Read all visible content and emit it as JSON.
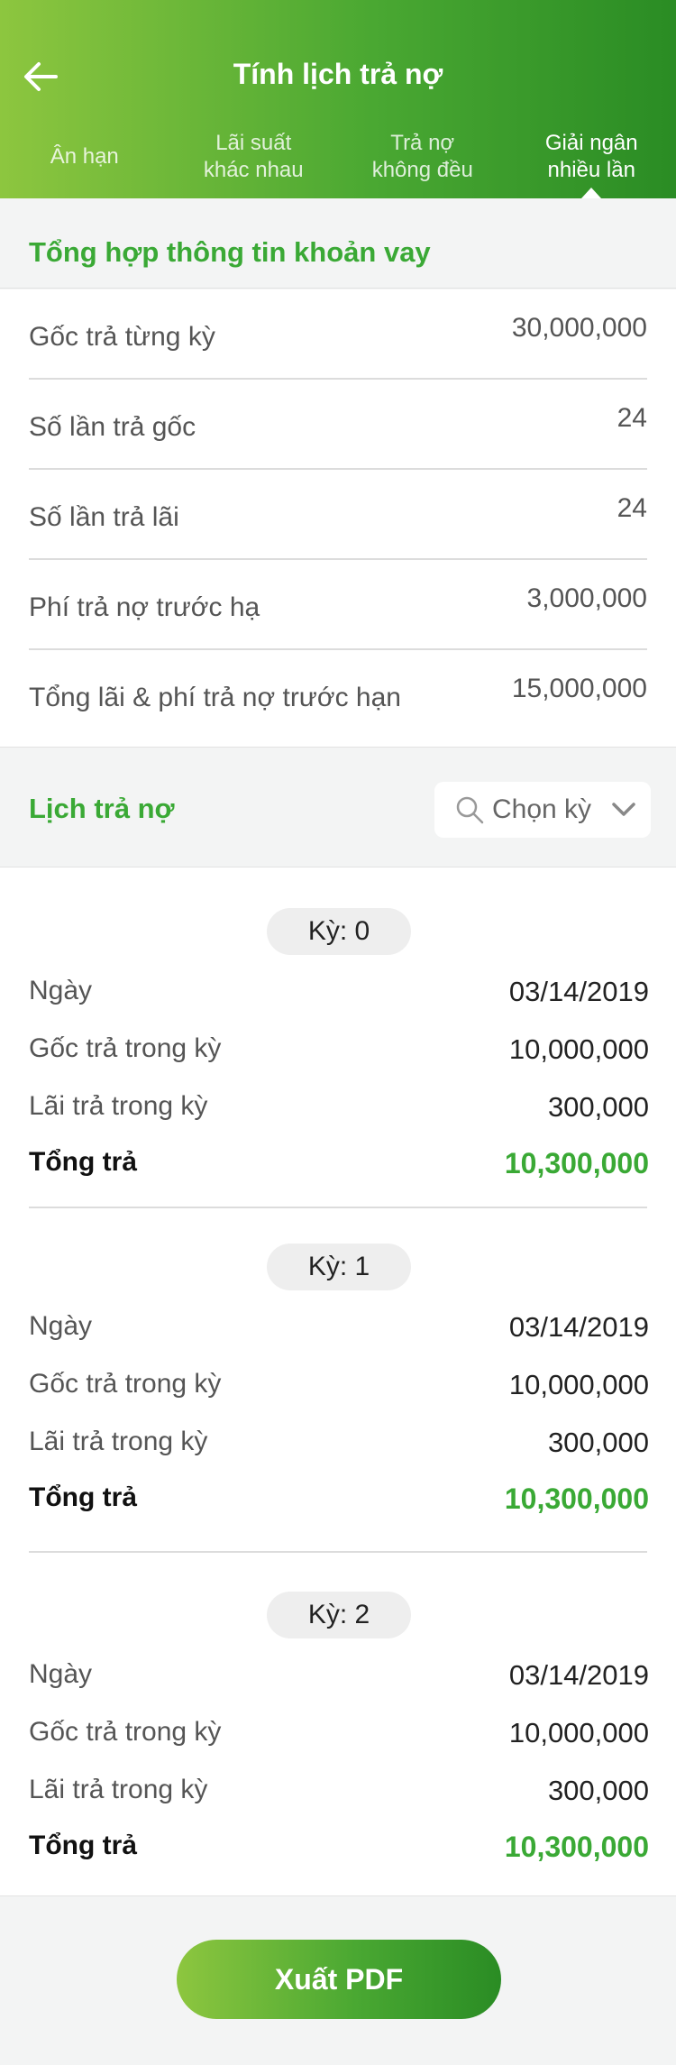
{
  "header": {
    "title": "Tính lịch trả nợ",
    "back_icon": "arrow-left-icon",
    "tabs": [
      {
        "label": "Ân hạn",
        "active": false
      },
      {
        "label": "Lãi suất\nkhác nhau",
        "active": false
      },
      {
        "label": "Trả nợ\nkhông đều",
        "active": false
      },
      {
        "label": "Giải ngân\nnhiều lần",
        "active": true
      }
    ]
  },
  "summary": {
    "title": "Tổng hợp thông tin khoản vay",
    "rows": [
      {
        "label": "Gốc trả từng kỳ",
        "value": "30,000,000"
      },
      {
        "label": "Số lần trả gốc",
        "value": "24"
      },
      {
        "label": "Số lần trả lãi",
        "value": "24"
      },
      {
        "label": "Phí trả nợ trước hạ",
        "value": "3,000,000"
      },
      {
        "label": "Tổng lãi & phí trả nợ trước hạn",
        "value": "15,000,000"
      }
    ]
  },
  "schedule": {
    "title": "Lịch trả nợ",
    "select_placeholder": "Chọn kỳ",
    "periods": [
      {
        "badge": "Kỳ: 0",
        "date_label": "Ngày",
        "date": "03/14/2019",
        "principal_label": "Gốc trả trong kỳ",
        "principal": "10,000,000",
        "interest_label": "Lãi trả trong kỳ",
        "interest": "300,000",
        "total_label": "Tổng trả",
        "total": "10,300,000"
      },
      {
        "badge": "Kỳ: 1",
        "date_label": "Ngày",
        "date": "03/14/2019",
        "principal_label": "Gốc trả trong kỳ",
        "principal": "10,000,000",
        "interest_label": "Lãi trả trong kỳ",
        "interest": "300,000",
        "total_label": "Tổng trả",
        "total": "10,300,000"
      },
      {
        "badge": "Kỳ: 2",
        "date_label": "Ngày",
        "date": "03/14/2019",
        "principal_label": "Gốc trả trong kỳ",
        "principal": "10,000,000",
        "interest_label": "Lãi trả trong kỳ",
        "interest": "300,000",
        "total_label": "Tổng trả",
        "total": "10,300,000"
      }
    ]
  },
  "footer": {
    "export_label": "Xuất PDF"
  },
  "colors": {
    "accent": "#3aa935",
    "gradient_start": "#8dc63f",
    "gradient_end": "#2a8c24"
  }
}
